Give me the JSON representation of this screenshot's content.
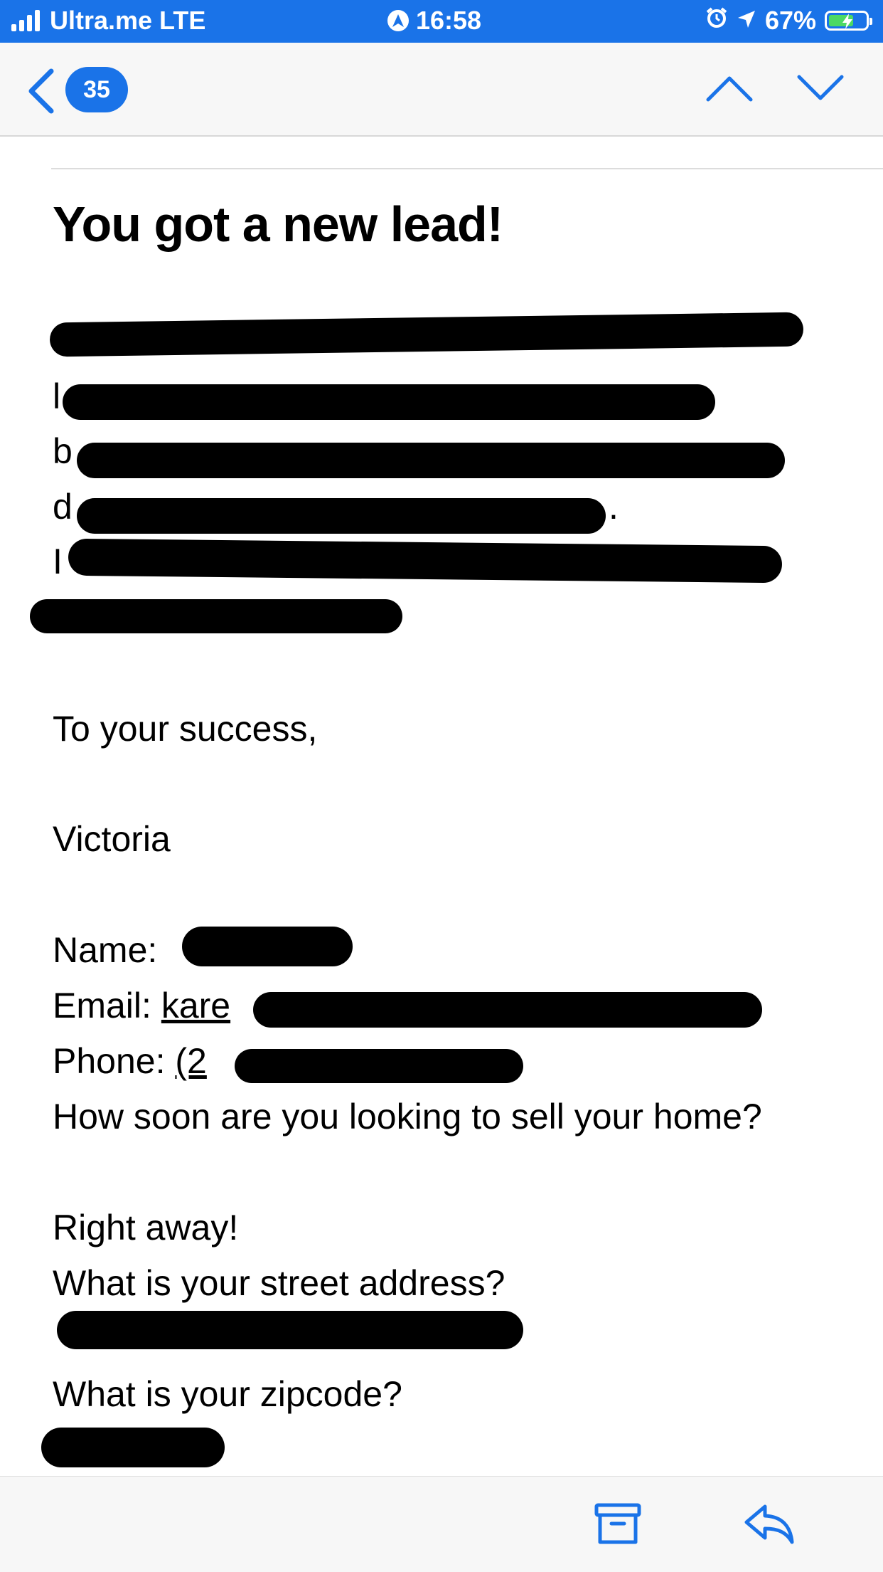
{
  "status_bar": {
    "carrier": "Ultra.me LTE",
    "time": "16:58",
    "battery": "67%",
    "battery_level": 0.67,
    "colors": {
      "background": "#1a73e8",
      "battery_fill": "#4cd964"
    }
  },
  "nav": {
    "back_icon": "chevron-left-icon",
    "unread_count": "35",
    "up_icon": "chevron-up-icon",
    "down_icon": "chevron-down-icon",
    "accent": "#1a73e8"
  },
  "email": {
    "title": "You got a new lead!",
    "closing": "To your success,",
    "signature": "Victoria",
    "name_label": "Name:",
    "email_label": "Email:",
    "email_visible": "kare",
    "phone_label": "Phone:",
    "phone_visible": "(2",
    "question_sell": "How soon are you looking to sell your home?",
    "answer_sell": "Right away!",
    "question_address": "What is your street address?",
    "question_zip": "What is your zipcode?",
    "body_visible_fragments": [
      "l",
      "b",
      "d",
      "I",
      "."
    ]
  },
  "toolbar": {
    "archive_icon": "archive-icon",
    "reply_icon": "reply-icon"
  }
}
